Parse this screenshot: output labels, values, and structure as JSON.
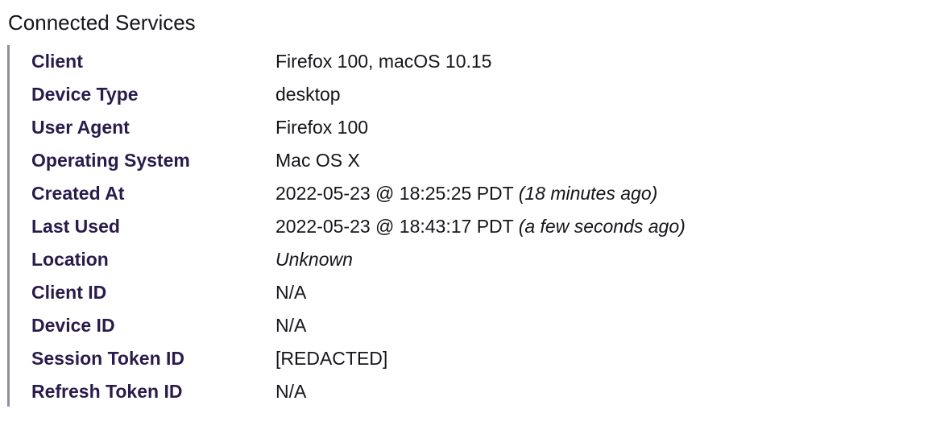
{
  "section": {
    "title": "Connected Services"
  },
  "details": [
    {
      "label": "Client",
      "value": "Firefox 100, macOS 10.15",
      "note": ""
    },
    {
      "label": "Device Type",
      "value": "desktop",
      "note": ""
    },
    {
      "label": "User Agent",
      "value": "Firefox 100",
      "note": ""
    },
    {
      "label": "Operating System",
      "value": "Mac OS X",
      "note": ""
    },
    {
      "label": "Created At",
      "value": "2022-05-23 @ 18:25:25 PDT",
      "note": "(18 minutes ago)"
    },
    {
      "label": "Last Used",
      "value": "2022-05-23 @ 18:43:17 PDT",
      "note": "(a few seconds ago)"
    },
    {
      "label": "Location",
      "value": "",
      "note": "Unknown"
    },
    {
      "label": "Client ID",
      "value": "N/A",
      "note": ""
    },
    {
      "label": "Device ID",
      "value": "N/A",
      "note": ""
    },
    {
      "label": "Session Token ID",
      "value": "[REDACTED]",
      "note": ""
    },
    {
      "label": "Refresh Token ID",
      "value": "N/A",
      "note": ""
    }
  ],
  "colors": {
    "label": "#2b1b4b",
    "text": "#15141a",
    "border": "#8f8f9d"
  }
}
